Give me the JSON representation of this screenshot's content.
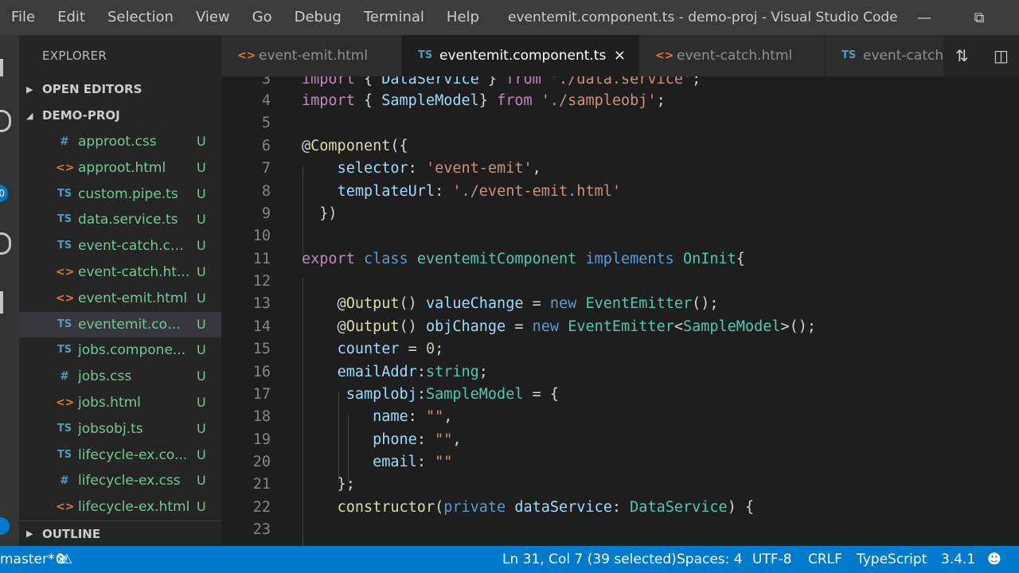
{
  "menu": [
    "File",
    "Edit",
    "Selection",
    "View",
    "Go",
    "Debug",
    "Terminal",
    "Help"
  ],
  "window_title": "eventemit.component.ts - demo-proj - Visual Studio Code",
  "activity_badge": "0",
  "explorer": {
    "title": "EXPLORER",
    "open_editors": "OPEN EDITORS",
    "project": "DEMO-PROJ",
    "outline": "OUTLINE",
    "files": [
      {
        "icon": "#",
        "type": "css",
        "name": "approot.css",
        "status": "U"
      },
      {
        "icon": "<>",
        "type": "html",
        "name": "approot.html",
        "status": "U"
      },
      {
        "icon": "TS",
        "type": "ts",
        "name": "custom.pipe.ts",
        "status": "U"
      },
      {
        "icon": "TS",
        "type": "ts",
        "name": "data.service.ts",
        "status": "U"
      },
      {
        "icon": "TS",
        "type": "ts",
        "name": "event-catch.co...",
        "status": "U"
      },
      {
        "icon": "<>",
        "type": "html",
        "name": "event-catch.ht...",
        "status": "U"
      },
      {
        "icon": "<>",
        "type": "html",
        "name": "event-emit.html",
        "status": "U"
      },
      {
        "icon": "TS",
        "type": "ts",
        "name": "eventemit.com...",
        "status": "U"
      },
      {
        "icon": "TS",
        "type": "ts",
        "name": "jobs.compone...",
        "status": "U"
      },
      {
        "icon": "#",
        "type": "css",
        "name": "jobs.css",
        "status": "U"
      },
      {
        "icon": "<>",
        "type": "html",
        "name": "jobs.html",
        "status": "U"
      },
      {
        "icon": "TS",
        "type": "ts",
        "name": "jobsobj.ts",
        "status": "U"
      },
      {
        "icon": "TS",
        "type": "ts",
        "name": "lifecycle-ex.co...",
        "status": "U"
      },
      {
        "icon": "#",
        "type": "css",
        "name": "lifecycle-ex.css",
        "status": "U"
      },
      {
        "icon": "<>",
        "type": "html",
        "name": "lifecycle-ex.html",
        "status": "U"
      }
    ]
  },
  "tabs": [
    {
      "icon": "<>",
      "label": "event-emit.html"
    },
    {
      "icon": "TS",
      "label": "eventemit.component.ts",
      "close": "×"
    },
    {
      "icon": "<>",
      "label": "event-catch.html"
    },
    {
      "icon": "TS",
      "label": "event-catch"
    }
  ],
  "editor": {
    "line_numbers": [
      "3",
      "4",
      "5",
      "6",
      "7",
      "8",
      "9",
      "10",
      "11",
      "12",
      "13",
      "14",
      "15",
      "16",
      "17",
      "18",
      "19",
      "20",
      "21",
      "22",
      "23"
    ]
  },
  "status": {
    "branch": "master*",
    "errors": "0",
    "warnings": "0",
    "position": "Ln 31, Col 7 (39 selected)",
    "spaces": "Spaces: 4",
    "encoding": "UTF-8",
    "eol": "CRLF",
    "language": "TypeScript",
    "version": "3.4.1"
  },
  "colors": {
    "statusbar": "#007acc",
    "editor_bg": "#1e1e1e",
    "sidebar_bg": "#252526",
    "untracked": "#73c991"
  }
}
